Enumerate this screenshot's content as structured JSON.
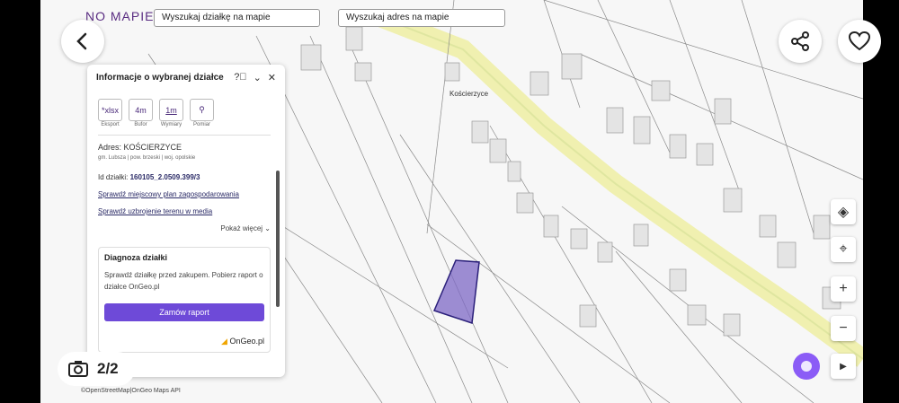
{
  "top_bar": {
    "logo": "NO MAPIE",
    "search_plot": "Wyszukaj działkę na mapie",
    "search_address": "Wyszukaj adres na mapie"
  },
  "panel": {
    "title": "Informacje o wybranej działce",
    "tools": [
      {
        "value": "*xlsx",
        "label": "Eksport"
      },
      {
        "value": "4m",
        "label": "Bufor"
      },
      {
        "value": "1m",
        "label": "Wymiary"
      },
      {
        "value": "",
        "label": "Pomiar"
      }
    ],
    "address": "Adres: KOŚCIERZYCE",
    "address_sub": "gm. Lubsza | pow. brzeski | woj. opolskie",
    "id_label": "Id działki:",
    "id_value": "160105_2.0509.399/3",
    "link_plan": "Sprawdź miejscowy plan zagospodarowania",
    "link_media": "Sprawdź uzbrojenie terenu w media",
    "show_more": "Pokaż więcej",
    "diag_title": "Diagnoza działki",
    "diag_text": "Sprawdź działkę przed zakupem. Pobierz raport o działce OnGeo.pl",
    "diag_button": "Zamów raport",
    "diag_brand": "OnGeo.pl"
  },
  "map": {
    "place_name": "Kościerzyce",
    "attribution": "©OpenStreetMap|OnGeo Maps API"
  },
  "viewer": {
    "counter": "2/2"
  },
  "colors": {
    "accent": "#6e4ad8",
    "brand": "#5a2d82",
    "selected_plot": "#7d68c6"
  }
}
